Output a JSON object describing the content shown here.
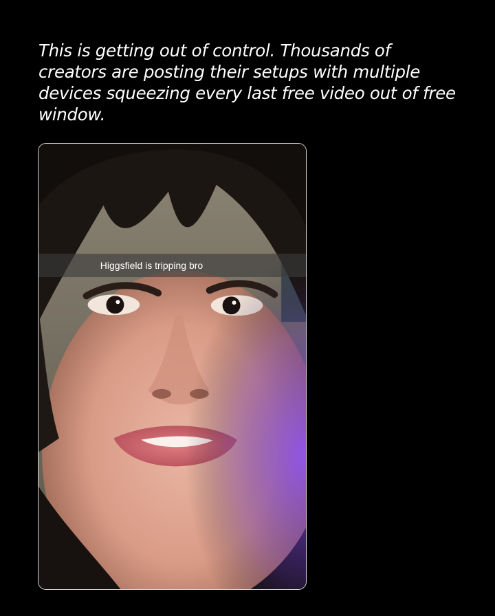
{
  "post": {
    "text": "This is getting out of control. Thousands of creators are posting their setups with multiple devices squeezing every last free video out of free window."
  },
  "media": {
    "caption": "Higgsfield is tripping bro",
    "frame_border_color": "#d9d9d9"
  },
  "colors": {
    "background": "#000000",
    "text": "#ffffff",
    "violet_glow": "#7a3cff"
  }
}
